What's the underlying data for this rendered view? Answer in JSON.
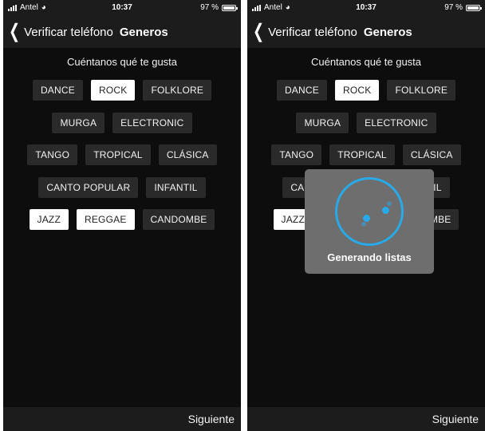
{
  "screens": [
    {
      "status": {
        "carrier": "Antel",
        "time": "10:37",
        "battery": "97 %"
      },
      "nav": {
        "back_label": "Verificar teléfono",
        "title": "Generos"
      },
      "prompt": "Cuéntanos qué te gusta",
      "footer": {
        "next_label": "Siguiente"
      }
    },
    {
      "status": {
        "carrier": "Antel",
        "time": "10:37",
        "battery": "97 %"
      },
      "nav": {
        "back_label": "Verificar teléfono",
        "title": "Generos"
      },
      "prompt": "Cuéntanos qué te gusta",
      "footer": {
        "next_label": "Siguiente"
      },
      "modal": {
        "label": "Generando listas"
      }
    }
  ],
  "genres": [
    {
      "label": "DANCE",
      "selected": false
    },
    {
      "label": "ROCK",
      "selected": true
    },
    {
      "label": "FOLKLORE",
      "selected": false
    },
    {
      "label": "MURGA",
      "selected": false
    },
    {
      "label": "ELECTRONIC",
      "selected": false
    },
    {
      "label": "TANGO",
      "selected": false
    },
    {
      "label": "TROPICAL",
      "selected": false
    },
    {
      "label": "CLÁSICA",
      "selected": false
    },
    {
      "label": "CANTO POPULAR",
      "selected": false
    },
    {
      "label": "INFANTIL",
      "selected": false
    },
    {
      "label": "JAZZ",
      "selected": true
    },
    {
      "label": "REGGAE",
      "selected": true
    },
    {
      "label": "CANDOMBE",
      "selected": false
    }
  ],
  "colors": {
    "background": "#0d0d0d",
    "bar": "#1c1c1c",
    "chip": "#2a2a2a",
    "chip_selected": "#ffffff",
    "spinner": "#29a9e8",
    "modal": "#6e6e6e"
  },
  "icons": {
    "back": "chevron-left-icon",
    "wifi": "wifi-icon",
    "signal": "signal-icon",
    "battery": "battery-icon",
    "loading": "spinner-icon"
  }
}
